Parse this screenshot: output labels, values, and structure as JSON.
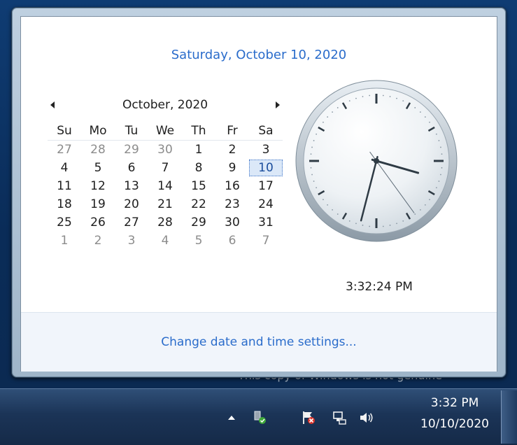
{
  "watermark": {
    "text": "This copy of Windows is not genuine",
    "side": "7"
  },
  "flyout": {
    "long_date": "Saturday, October 10, 2020",
    "calendar": {
      "month_title": "October, 2020",
      "weekdays": [
        "Su",
        "Mo",
        "Tu",
        "We",
        "Th",
        "Fr",
        "Sa"
      ],
      "weeks": [
        [
          "27",
          "28",
          "29",
          "30",
          "1",
          "2",
          "3"
        ],
        [
          "4",
          "5",
          "6",
          "7",
          "8",
          "9",
          "10"
        ],
        [
          "11",
          "12",
          "13",
          "14",
          "15",
          "16",
          "17"
        ],
        [
          "18",
          "19",
          "20",
          "21",
          "22",
          "23",
          "24"
        ],
        [
          "25",
          "26",
          "27",
          "28",
          "29",
          "30",
          "31"
        ],
        [
          "1",
          "2",
          "3",
          "4",
          "5",
          "6",
          "7"
        ]
      ],
      "today": "10"
    },
    "clock": {
      "hours": 3,
      "minutes": 32,
      "seconds": 24
    },
    "time_text": "3:32:24 PM",
    "settings_link": "Change date and time settings..."
  },
  "taskbar": {
    "tray_time": "3:32 PM",
    "tray_date": "10/10/2020",
    "tray_icons": [
      "show-hidden-icons-arrow-icon",
      "network-ok-icon",
      "action-center-flag-icon",
      "network-connection-icon",
      "speaker-volume-icon"
    ]
  },
  "colors": {
    "accent_link": "#2a6ccb",
    "taskbar": "#1b3457"
  }
}
